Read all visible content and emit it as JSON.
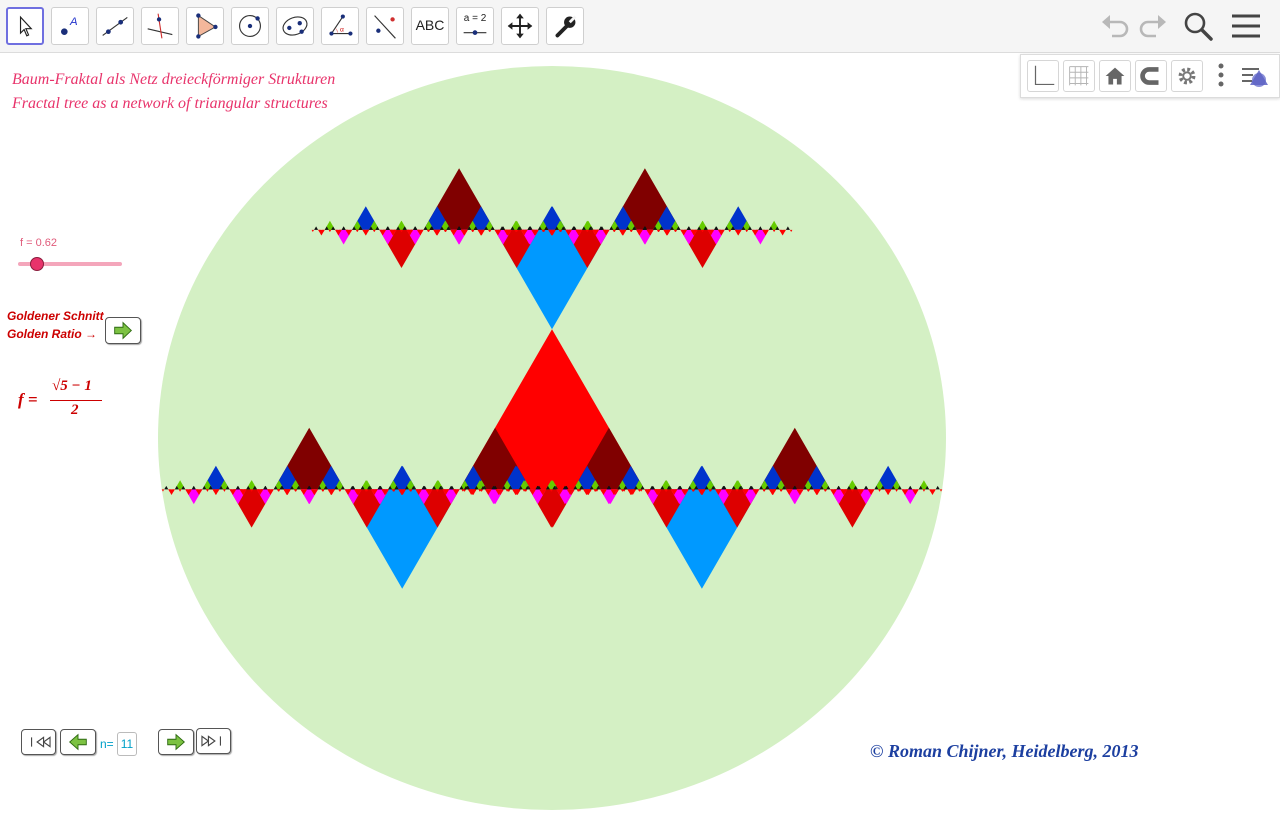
{
  "toolbar": {
    "tools": [
      {
        "name": "move-tool",
        "text": ""
      },
      {
        "name": "point-tool",
        "text": ""
      },
      {
        "name": "line-tool",
        "text": ""
      },
      {
        "name": "perpendicular-line-tool",
        "text": ""
      },
      {
        "name": "polygon-tool",
        "text": ""
      },
      {
        "name": "circle-tool",
        "text": ""
      },
      {
        "name": "ellipse-tool",
        "text": ""
      },
      {
        "name": "angle-tool",
        "text": ""
      },
      {
        "name": "reflect-tool",
        "text": ""
      },
      {
        "name": "text-tool",
        "text": "ABC"
      },
      {
        "name": "slider-tool",
        "text": "a = 2"
      },
      {
        "name": "move-graphics-view-tool",
        "text": ""
      },
      {
        "name": "settings-tool",
        "text": ""
      }
    ],
    "right_icons": [
      "undo-icon",
      "redo-icon",
      "search-icon",
      "menu-icon"
    ]
  },
  "stylebar": {
    "icons": [
      "axes-icon",
      "grid-icon",
      "home-icon",
      "magnet-icon",
      "gear-icon",
      "more-icon",
      "style-bar-toggle-icon"
    ]
  },
  "canvas": {
    "title_de": "Baum-Fraktal als Netz dreieckförmiger  Strukturen",
    "title_en": "Fractal tree as a network of triangular structures",
    "slider": {
      "label": "f = 0.62",
      "value": 0.62,
      "min": 0,
      "max": 1
    },
    "golden_de": "Goldener Schnitt",
    "golden_en": "Golden Ratio →",
    "formula": {
      "lhs": "f =",
      "numerator": "√5 − 1",
      "denominator": "2"
    },
    "nav": {
      "label": "n=",
      "value": "11"
    },
    "copyright": "© Roman Chijner, Heidelberg, 2013"
  },
  "fractal": {
    "center_color": "#ff0000",
    "level1_color": "#0099ff",
    "level2_color": "#800000",
    "level3_color": "#dd0000",
    "level4_color": "#0033cc",
    "level5_color": "#ff00ff",
    "level6_color": "#66cc00",
    "deep_colors": [
      "#ff0000",
      "#111111"
    ],
    "background_color": "#d4f0c4",
    "depth": 11,
    "ratio": 0.62
  }
}
